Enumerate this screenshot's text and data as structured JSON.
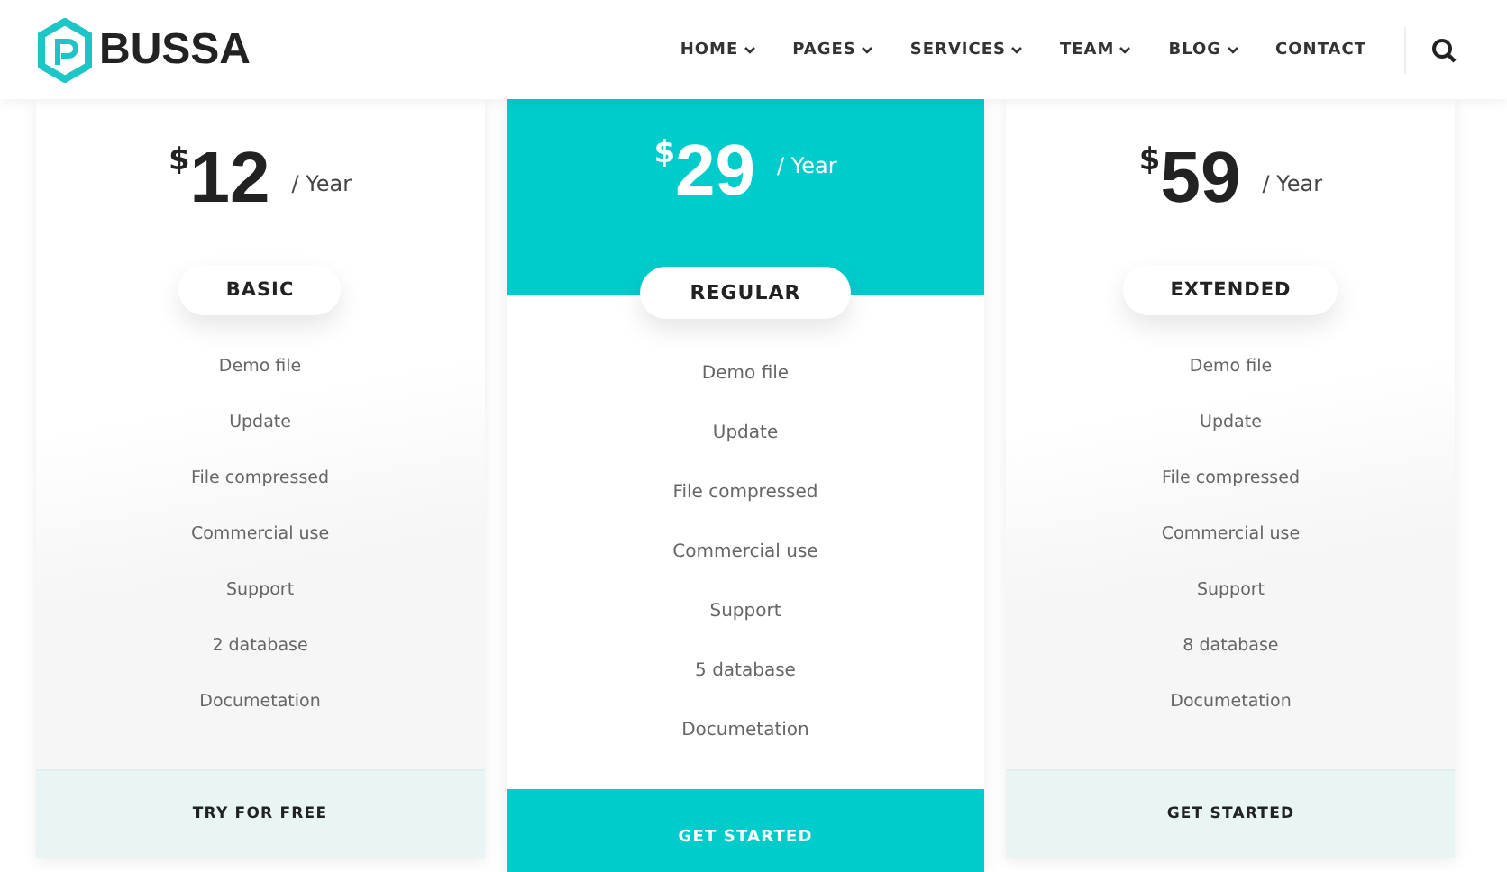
{
  "header": {
    "logo": "BUSSA",
    "nav": [
      {
        "label": "HOME",
        "dropdown": true
      },
      {
        "label": "PAGES",
        "dropdown": true
      },
      {
        "label": "SERVICES",
        "dropdown": true
      },
      {
        "label": "TEAM",
        "dropdown": true
      },
      {
        "label": "BLOG",
        "dropdown": true
      },
      {
        "label": "CONTACT",
        "dropdown": false
      }
    ]
  },
  "plans": [
    {
      "currency": "$",
      "price": "12",
      "period": "/ Year",
      "name": "BASIC",
      "featured": false,
      "features": [
        "Demo file",
        "Update",
        "File compressed",
        "Commercial use",
        "Support",
        "2 database",
        "Documetation"
      ],
      "button": "TRY FOR FREE"
    },
    {
      "currency": "$",
      "price": "29",
      "period": "/ Year",
      "name": "REGULAR",
      "featured": true,
      "features": [
        "Demo file",
        "Update",
        "File compressed",
        "Commercial use",
        "Support",
        "5 database",
        "Documetation"
      ],
      "button": "GET STARTED"
    },
    {
      "currency": "$",
      "price": "59",
      "period": "/ Year",
      "name": "EXTENDED",
      "featured": false,
      "features": [
        "Demo file",
        "Update",
        "File compressed",
        "Commercial use",
        "Support",
        "8 database",
        "Documetation"
      ],
      "button": "GET STARTED"
    }
  ]
}
